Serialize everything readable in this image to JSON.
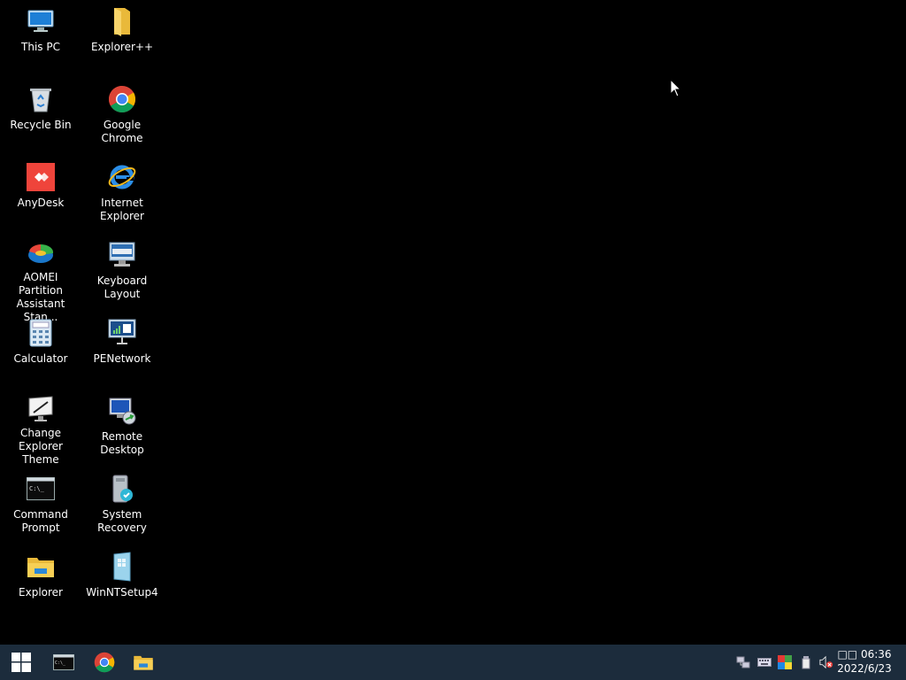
{
  "desktop": {
    "icons": [
      {
        "label": "This PC",
        "icon": "computer-icon"
      },
      {
        "label": "Explorer++",
        "icon": "folder-icon"
      },
      {
        "label": "Recycle Bin",
        "icon": "recycle-bin-icon"
      },
      {
        "label": "Google Chrome",
        "icon": "chrome-icon"
      },
      {
        "label": "AnyDesk",
        "icon": "anydesk-icon"
      },
      {
        "label": "Internet Explorer",
        "icon": "internet-explorer-icon"
      },
      {
        "label": "AOMEI Partition Assistant Stan...",
        "icon": "partition-icon"
      },
      {
        "label": "Keyboard Layout",
        "icon": "keyboard-icon"
      },
      {
        "label": "Calculator",
        "icon": "calculator-icon"
      },
      {
        "label": "PENetwork",
        "icon": "network-icon"
      },
      {
        "label": "Change Explorer Theme",
        "icon": "monitor-icon"
      },
      {
        "label": "Remote Desktop",
        "icon": "remote-desktop-icon"
      },
      {
        "label": "Command Prompt",
        "icon": "terminal-icon"
      },
      {
        "label": "System Recovery",
        "icon": "recovery-icon"
      },
      {
        "label": "Explorer",
        "icon": "file-explorer-icon"
      },
      {
        "label": "WinNTSetup4",
        "icon": "setup-icon"
      }
    ]
  },
  "taskbar": {
    "pinned": [
      {
        "name": "Command Prompt",
        "icon": "terminal-icon"
      },
      {
        "name": "Google Chrome",
        "icon": "chrome-icon"
      },
      {
        "name": "Explorer",
        "icon": "file-explorer-icon"
      }
    ],
    "tray": {
      "time": "□□ 06:36",
      "date": "2022/6/23"
    }
  },
  "colors": {
    "desktop_bg": "#000000",
    "taskbar_bg": "#1c2c3c"
  }
}
